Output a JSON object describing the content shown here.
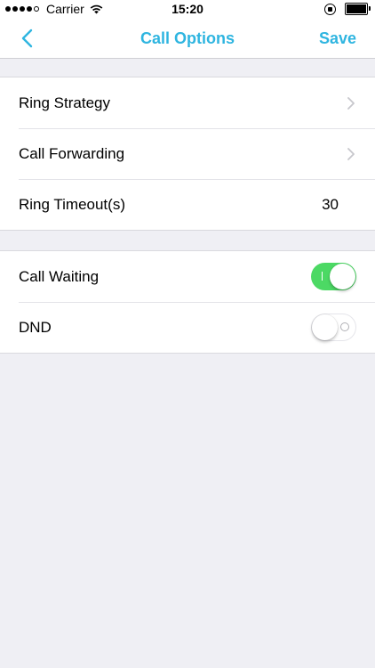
{
  "status_bar": {
    "carrier": "Carrier",
    "time": "15:20",
    "signal_bars_filled": 4,
    "signal_bars_total": 5
  },
  "nav": {
    "back_icon": "chevron-left-icon",
    "title": "Call Options",
    "save_label": "Save",
    "accent_color": "#2fb5e0"
  },
  "settings_group_1": {
    "ring_strategy_label": "Ring Strategy",
    "call_forwarding_label": "Call Forwarding",
    "ring_timeout_label": "Ring Timeout(s)",
    "ring_timeout_value": "30"
  },
  "settings_group_2": {
    "call_waiting_label": "Call Waiting",
    "call_waiting_enabled": true,
    "dnd_label": "DND",
    "dnd_enabled": false,
    "toggle_on_color": "#4cd964"
  }
}
